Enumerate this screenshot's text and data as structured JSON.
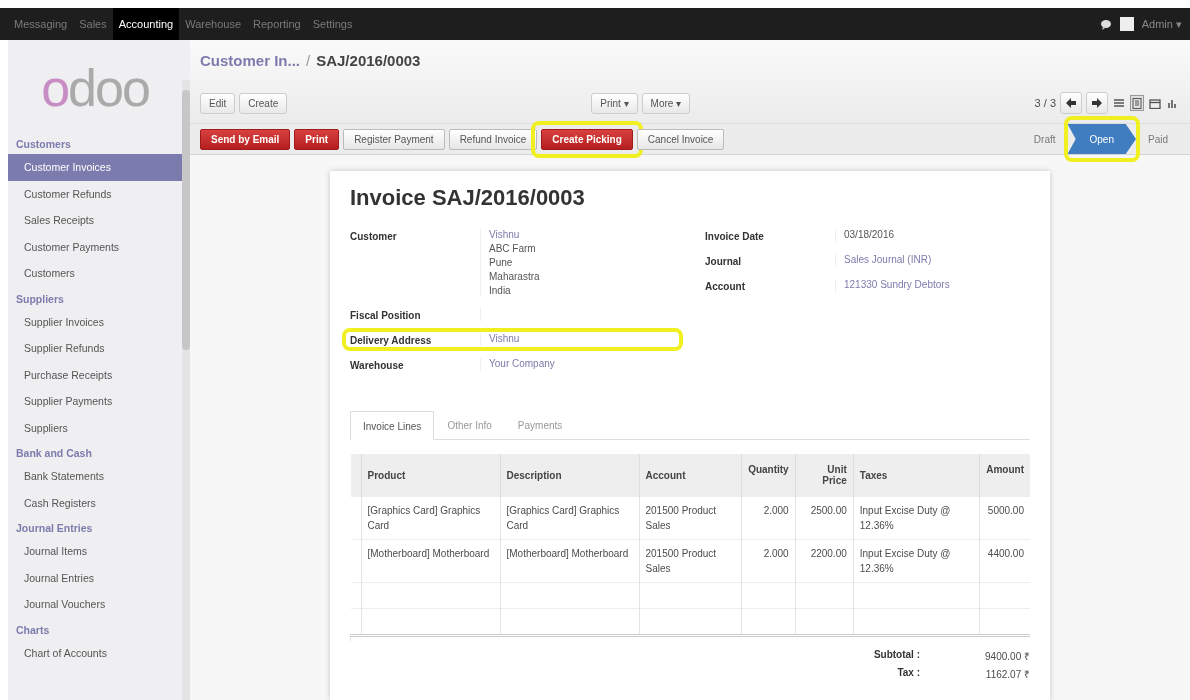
{
  "top_menu": [
    {
      "label": "Messaging",
      "selected": false
    },
    {
      "label": "Sales",
      "selected": false
    },
    {
      "label": "Accounting",
      "selected": true
    },
    {
      "label": "Warehouse",
      "selected": false
    },
    {
      "label": "Reporting",
      "selected": false
    },
    {
      "label": "Settings",
      "selected": false
    }
  ],
  "user": {
    "name": "Admin ▾"
  },
  "logo": "odoo",
  "sidebar": [
    {
      "title": "Customers",
      "items": [
        {
          "label": "Customer Invoices",
          "selected": true
        },
        {
          "label": "Customer Refunds",
          "selected": false
        },
        {
          "label": "Sales Receipts",
          "selected": false
        },
        {
          "label": "Customer Payments",
          "selected": false
        },
        {
          "label": "Customers",
          "selected": false
        }
      ]
    },
    {
      "title": "Suppliers",
      "items": [
        {
          "label": "Supplier Invoices",
          "selected": false
        },
        {
          "label": "Supplier Refunds",
          "selected": false
        },
        {
          "label": "Purchase Receipts",
          "selected": false
        },
        {
          "label": "Supplier Payments",
          "selected": false
        },
        {
          "label": "Suppliers",
          "selected": false
        }
      ]
    },
    {
      "title": "Bank and Cash",
      "items": [
        {
          "label": "Bank Statements",
          "selected": false
        },
        {
          "label": "Cash Registers",
          "selected": false
        }
      ]
    },
    {
      "title": "Journal Entries",
      "items": [
        {
          "label": "Journal Items",
          "selected": false
        },
        {
          "label": "Journal Entries",
          "selected": false
        },
        {
          "label": "Journal Vouchers",
          "selected": false
        }
      ]
    },
    {
      "title": "Charts",
      "items": [
        {
          "label": "Chart of Accounts",
          "selected": false
        }
      ]
    }
  ],
  "breadcrumb": {
    "parent": "Customer In...",
    "separator": "/",
    "current": "SAJ/2016/0003"
  },
  "view_buttons": [
    "Edit",
    "Create"
  ],
  "dropdowns": [
    "Print ▾",
    "More ▾"
  ],
  "pager": "3 / 3",
  "view_modes": [
    {
      "kind": "list",
      "selected": false
    },
    {
      "kind": "form",
      "selected": true
    },
    {
      "kind": "calendar",
      "selected": false
    },
    {
      "kind": "graph",
      "selected": false
    }
  ],
  "actions": [
    {
      "label": "Send by Email",
      "primary": true,
      "highlighted": false
    },
    {
      "label": "Print",
      "primary": true,
      "highlighted": false
    },
    {
      "label": "Register Payment",
      "primary": false,
      "highlighted": false
    },
    {
      "label": "Refund Invoice",
      "primary": false,
      "highlighted": false
    },
    {
      "label": "Create Picking",
      "primary": true,
      "highlighted": true
    },
    {
      "label": "Cancel Invoice",
      "primary": false,
      "highlighted": false
    }
  ],
  "stages": [
    {
      "label": "Draft",
      "selected": false,
      "highlighted": false
    },
    {
      "label": "Open",
      "selected": true,
      "highlighted": true
    },
    {
      "label": "Paid",
      "selected": false,
      "highlighted": false
    }
  ],
  "invoice": {
    "title": "Invoice SAJ/2016/0003",
    "left_fields": [
      {
        "label": "Customer",
        "highlighted": false,
        "values": [
          {
            "text": "Vishnu",
            "link": true
          },
          {
            "text": "ABC Farm",
            "link": false
          },
          {
            "text": "Pune",
            "link": false
          },
          {
            "text": "Maharastra",
            "link": false
          },
          {
            "text": "India",
            "link": false
          }
        ]
      },
      {
        "label": "Fiscal Position",
        "highlighted": false
      },
      {
        "label": "Delivery Address",
        "highlighted": true,
        "values": [
          {
            "text": "Vishnu",
            "link": true
          }
        ]
      },
      {
        "label": "Warehouse",
        "highlighted": false,
        "values": [
          {
            "text": "Your Company",
            "link": true
          }
        ]
      }
    ],
    "right_fields": [
      {
        "label": "Invoice Date",
        "highlighted": false,
        "values": [
          {
            "text": "03/18/2016",
            "link": false
          }
        ]
      },
      {
        "label": "Journal",
        "highlighted": false,
        "values": [
          {
            "text": "Sales Journal (INR)",
            "link": true
          }
        ]
      },
      {
        "label": "Account",
        "highlighted": false,
        "values": [
          {
            "text": "121330 Sundry Debtors",
            "link": true
          }
        ]
      }
    ],
    "tabs": [
      {
        "label": "Invoice Lines",
        "selected": true
      },
      {
        "label": "Other Info",
        "selected": false
      },
      {
        "label": "Payments",
        "selected": false
      }
    ],
    "table": {
      "columns": [
        {
          "label": "Product",
          "numeric": false
        },
        {
          "label": "Description",
          "numeric": false
        },
        {
          "label": "Account",
          "numeric": false
        },
        {
          "label": "Quantity",
          "numeric": true
        },
        {
          "label": "Unit Price",
          "numeric": true
        },
        {
          "label": "Taxes",
          "numeric": false
        },
        {
          "label": "Amount",
          "numeric": true
        }
      ],
      "rows": [
        [
          "[Graphics Card] Graphics Card",
          "[Graphics Card] Graphics Card",
          "201500 Product Sales",
          "2.000",
          "2500.00",
          "Input Excise Duty @ 12.36%",
          "5000.00"
        ],
        [
          "[Motherboard] Motherboard",
          "[Motherboard] Motherboard",
          "201500 Product Sales",
          "2.000",
          "2200.00",
          "Input Excise Duty @ 12.36%",
          "4400.00"
        ]
      ]
    },
    "totals": [
      {
        "label": "Subtotal :",
        "value": "9400.00 ₹"
      },
      {
        "label": "Tax :",
        "value": "1162.07 ₹"
      }
    ]
  }
}
